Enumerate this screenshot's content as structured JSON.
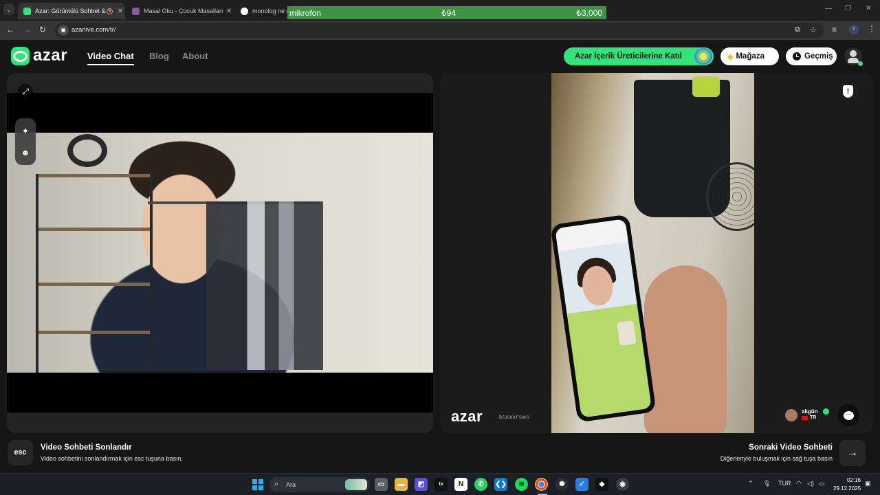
{
  "browser": {
    "tabs": [
      {
        "title": "Azar: Görüntülü Sohbet & Y",
        "active": true
      },
      {
        "title": "Masal Oku - Çocuk Masalları - I",
        "active": false
      },
      {
        "title": "monolog ne d",
        "active": false
      }
    ],
    "url": "azarlive.com/tr/",
    "profile_initial": "Y"
  },
  "mic_overlay": {
    "label": "mikrofon",
    "left_value": "₺94",
    "right_value": "₺3,000"
  },
  "site": {
    "logo_text": "azar",
    "nav": [
      {
        "label": "Video Chat",
        "active": true
      },
      {
        "label": "Blog",
        "active": false
      },
      {
        "label": "About",
        "active": false
      }
    ],
    "cta_label": "Azar İçerik Üreticilerine Katıl",
    "shop_label": "Mağaza",
    "history_label": "Geçmiş"
  },
  "remote": {
    "watermark_logo": "azar",
    "watermark_code": "B5J0KKFSWS",
    "peer_name": "akgün",
    "peer_country": "TR"
  },
  "hints": {
    "esc_key": "esc",
    "end_title": "Video Sohbeti Sonlandır",
    "end_sub": "Video sohbetini sonlandırmak için esc tuşuna basın.",
    "next_title": "Sonraki Video Sohbeti",
    "next_sub": "Diğerleriyle buluşmak için sağ tuşa basın",
    "next_key": "→"
  },
  "taskbar": {
    "search_placeholder": "Ara",
    "language": "TUR",
    "time": "02:16",
    "date": "29.12.2025"
  },
  "colors": {
    "accent": "#33e27b",
    "background": "#161616",
    "mic_bar": "#3e9444"
  },
  "icons": [
    "tab-search-icon",
    "record-icon",
    "close-icon",
    "back-icon",
    "forward-icon",
    "reload-icon",
    "site-info-icon",
    "install-icon",
    "bookmark-star-icon",
    "media-icon",
    "menu-icon",
    "gem-icon",
    "clock-icon",
    "expand-icon",
    "sparkle-icon",
    "face-filter-icon",
    "report-icon",
    "chat-bubble-icon",
    "arrow-right-icon",
    "windows-icon",
    "search-icon",
    "wifi-icon",
    "speaker-icon",
    "battery-icon",
    "mic-icon"
  ]
}
